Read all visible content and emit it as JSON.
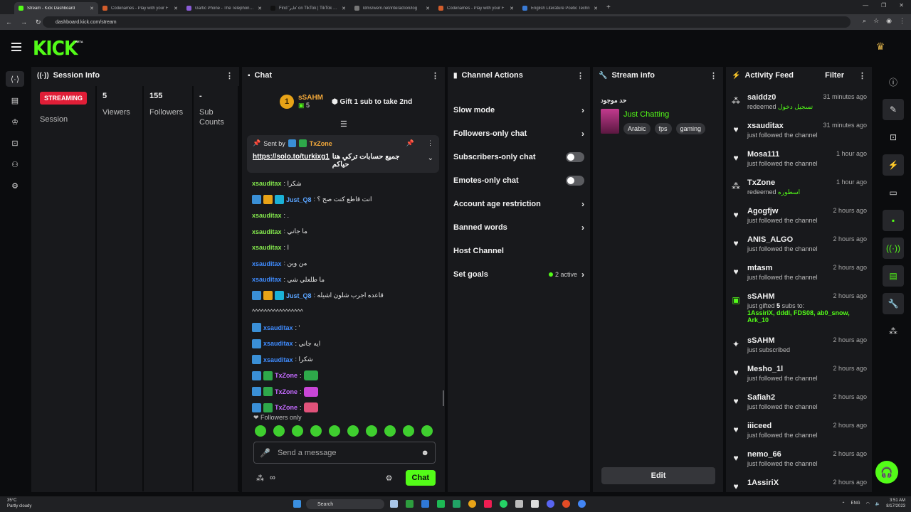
{
  "browser": {
    "tabs": [
      {
        "title": "Stream - Kick Dashboard",
        "color": "#53fc18",
        "active": true
      },
      {
        "title": "Codenames - Play with your F",
        "color": "#d35d2b",
        "active": false
      },
      {
        "title": "Gartic Phone - The Telephone G",
        "color": "#8a5cd8",
        "active": false
      },
      {
        "title": "Find 'فاير' on TikTok | TikTok Se",
        "color": "#111111",
        "active": false
      },
      {
        "title": "ldms/ivem.net/interaction/log",
        "color": "#777777",
        "active": false
      },
      {
        "title": "Codenames - Play with your F",
        "color": "#d35d2b",
        "active": false
      },
      {
        "title": "English Literature Poetic Techn",
        "color": "#3a7bd5",
        "active": false
      }
    ],
    "url": "dashboard.kick.com/stream"
  },
  "header": {
    "logo": "KICK",
    "beta": "BETA"
  },
  "session": {
    "title": "Session Info",
    "status": "STREAMING",
    "status_label": "Session",
    "viewers": "5",
    "viewers_label": "Viewers",
    "followers": "155",
    "followers_label": "Followers",
    "subs": "-",
    "subs_label_1": "Sub",
    "subs_label_2": "Counts"
  },
  "chat": {
    "title": "Chat",
    "gift_user": "sSAHM",
    "gift_count": "5",
    "gift_rank": "1",
    "gift_text": "Gift 1 sub to take 2nd",
    "pinned_by_label": "Sent by",
    "pinned_user": "TxZone",
    "pinned_text": "جميع حسابات تركي هنا حياكم",
    "pinned_link": "https://solo.to/turkixg1",
    "messages": [
      {
        "user": "xsauditax",
        "color": "u-g",
        "badges": [],
        "text": ": شكرا"
      },
      {
        "user": "Just_Q8",
        "color": "u-bl",
        "badges": [
          "b1",
          "b2",
          "b3"
        ],
        "text": ": انت قاطع كنت صح ؟"
      },
      {
        "user": "xsauditax",
        "color": "u-g",
        "badges": [],
        "text": ": ."
      },
      {
        "user": "xsauditax",
        "color": "u-g",
        "badges": [],
        "text": ": ما جاني"
      },
      {
        "user": "xsauditax",
        "color": "u-g",
        "badges": [],
        "text": ": ا"
      },
      {
        "user": "xsauditax",
        "color": "u-b",
        "badges": [],
        "text": ": من وين"
      },
      {
        "user": "xsauditax",
        "color": "u-b",
        "badges": [],
        "text": ": ما طلعلي شي"
      },
      {
        "user": "Just_Q8",
        "color": "u-bl",
        "badges": [
          "b1",
          "b2",
          "b3"
        ],
        "text": ": قاعده اجرب شلون اشيله"
      },
      {
        "user": "",
        "color": "u-g",
        "badges": [],
        "text": "^^^^^^^^^^^^^^^^^"
      },
      {
        "user": "xsauditax",
        "color": "u-b",
        "badges": [
          "b1"
        ],
        "text": ": '"
      },
      {
        "user": "xsauditax",
        "color": "u-b",
        "badges": [
          "b1"
        ],
        "text": ": ايه جاني"
      },
      {
        "user": "xsauditax",
        "color": "u-b",
        "badges": [
          "b1"
        ],
        "text": ": شكرا"
      },
      {
        "user": "TxZone",
        "color": "u-p",
        "badges": [
          "b1",
          "b4"
        ],
        "text": ":",
        "emote": "#2ea84a"
      },
      {
        "user": "TxZone",
        "color": "u-p",
        "badges": [
          "b1",
          "b4"
        ],
        "text": ":",
        "emote": "#c846d6"
      },
      {
        "user": "TxZone",
        "color": "u-p",
        "badges": [
          "b1",
          "b4"
        ],
        "text": ":",
        "emote": "#e0527a"
      }
    ],
    "followers_only": "Followers only",
    "placeholder": "Send a message",
    "infinity": "∞",
    "send_label": "Chat"
  },
  "channel_actions": {
    "title": "Channel Actions",
    "items": [
      {
        "label": "Slow mode",
        "kind": "arrow"
      },
      {
        "label": "Followers-only chat",
        "kind": "arrow"
      },
      {
        "label": "Subscribers-only chat",
        "kind": "toggle"
      },
      {
        "label": "Emotes-only chat",
        "kind": "toggle"
      },
      {
        "label": "Account age restriction",
        "kind": "arrow"
      },
      {
        "label": "Banned words",
        "kind": "arrow"
      },
      {
        "label": "Host Channel",
        "kind": "none"
      },
      {
        "label": "Set goals",
        "kind": "goals",
        "extra": "2 active"
      }
    ]
  },
  "stream_info": {
    "title": "Stream info",
    "stream_title": "حد موجود",
    "category": "Just Chatting",
    "tags": [
      "Arabic",
      "fps",
      "gaming"
    ],
    "edit_label": "Edit"
  },
  "activity": {
    "title": "Activity Feed",
    "filter": "Filter",
    "items": [
      {
        "user": "saiddz0",
        "time": "31 minutes ago",
        "kind": "redeem",
        "text": "redeemed",
        "extra": "تسجيل دخول"
      },
      {
        "user": "xsauditax",
        "time": "31 minutes ago",
        "kind": "follow",
        "text": "just followed the channel"
      },
      {
        "user": "Mosa111",
        "time": "1 hour ago",
        "kind": "follow",
        "text": "just followed the channel"
      },
      {
        "user": "TxZone",
        "time": "1 hour ago",
        "kind": "redeem",
        "text": "redeemed",
        "extra": "اسطوره"
      },
      {
        "user": "Agogfjw",
        "time": "2 hours ago",
        "kind": "follow",
        "text": "just followed the channel"
      },
      {
        "user": "ANIS_ALGO",
        "time": "2 hours ago",
        "kind": "follow",
        "text": "just followed the channel"
      },
      {
        "user": "mtasm",
        "time": "2 hours ago",
        "kind": "follow",
        "text": "just followed the channel"
      },
      {
        "user": "sSAHM",
        "time": "2 hours ago",
        "kind": "gift",
        "text": "just gifted",
        "count": "5",
        "text2": "subs to:",
        "recipients": "1AssiriX, dddl, FDS08, ab0_snow, Ark_10"
      },
      {
        "user": "sSAHM",
        "time": "2 hours ago",
        "kind": "sub",
        "text": "just subscribed"
      },
      {
        "user": "Mesho_1l",
        "time": "2 hours ago",
        "kind": "follow",
        "text": "just followed the channel"
      },
      {
        "user": "Safiah2",
        "time": "2 hours ago",
        "kind": "follow",
        "text": "just followed the channel"
      },
      {
        "user": "iiiceed",
        "time": "2 hours ago",
        "kind": "follow",
        "text": "just followed the channel"
      },
      {
        "user": "nemo_66",
        "time": "2 hours ago",
        "kind": "follow",
        "text": "just followed the channel"
      },
      {
        "user": "1AssiriX",
        "time": "2 hours ago",
        "kind": "follow",
        "text": ""
      }
    ]
  },
  "taskbar": {
    "temp": "35°C",
    "weather": "Partly cloudy",
    "search": "Search",
    "lang": "ENG",
    "time": "3:51 AM",
    "date": "8/17/2023"
  }
}
